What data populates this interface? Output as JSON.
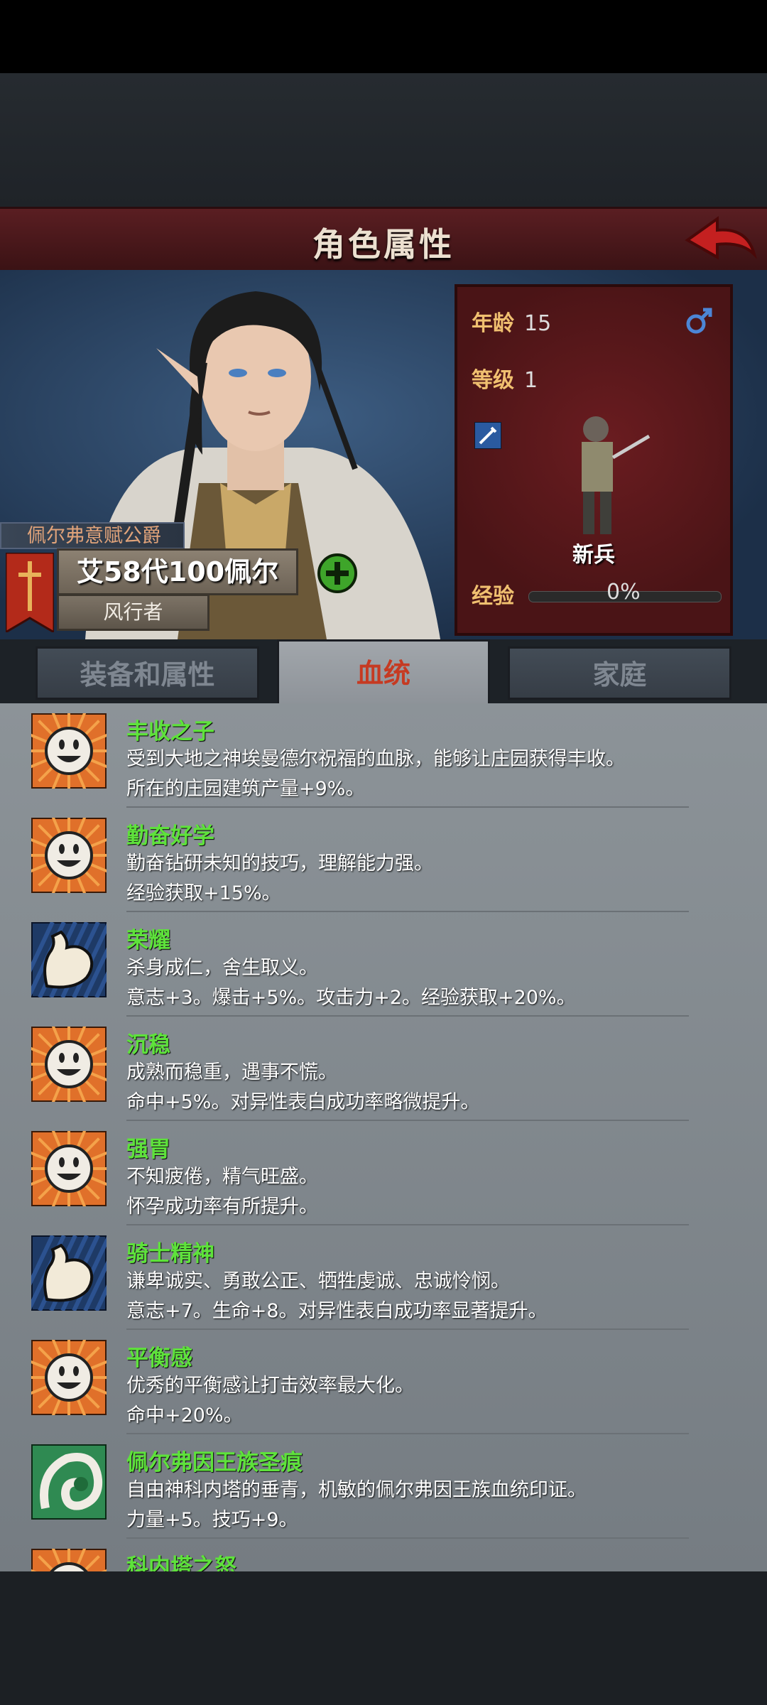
{
  "header": {
    "title": "角色属性"
  },
  "character": {
    "title": "佩尔弗意赋公爵",
    "name": "艾58代100佩尔",
    "class": "风行者",
    "age_label": "年龄",
    "age": "15",
    "level_label": "等级",
    "level": "1",
    "unit_name": "新兵",
    "exp_label": "经验",
    "exp_percent": "0%",
    "exp_fraction": 0
  },
  "tabs": [
    {
      "label": "装备和属性"
    },
    {
      "label": "血统"
    },
    {
      "label": "家庭"
    }
  ],
  "active_tab": 1,
  "traits": [
    {
      "name": "丰收之子",
      "icon": "smiley-icon",
      "desc": "受到大地之神埃曼德尔祝福的血脉，能够让庄园获得丰收。",
      "effect": "所在的庄园建筑产量+9%。"
    },
    {
      "name": "勤奋好学",
      "icon": "smiley-icon",
      "desc": "勤奋钻研未知的技巧，理解能力强。",
      "effect": "经验获取+15%。"
    },
    {
      "name": "荣耀",
      "icon": "muscle-arm-icon",
      "desc": "杀身成仁，舍生取义。",
      "effect": "意志+3。爆击+5%。攻击力+2。经验获取+20%。"
    },
    {
      "name": "沉稳",
      "icon": "smiley-icon",
      "desc": "成熟而稳重，遇事不慌。",
      "effect": "命中+5%。对异性表白成功率略微提升。"
    },
    {
      "name": "强胃",
      "icon": "smiley-icon",
      "desc": "不知疲倦，精气旺盛。",
      "effect": "怀孕成功率有所提升。"
    },
    {
      "name": "骑士精神",
      "icon": "muscle-arm-icon",
      "desc": "谦卑诚实、勇敢公正、牺牲虔诚、忠诚怜悯。",
      "effect": "意志+7。生命+8。对异性表白成功率显著提升。"
    },
    {
      "name": "平衡感",
      "icon": "smiley-icon",
      "desc": "优秀的平衡感让打击效率最大化。",
      "effect": "命中+20%。"
    },
    {
      "name": "佩尔弗因王族圣痕",
      "icon": "swirl-icon",
      "desc": "自由神科内塔的垂青，机敏的佩尔弗因王族血统印证。",
      "effect": "力量+5。技巧+9。"
    },
    {
      "name": "科内塔之怒",
      "icon": "smiley-icon",
      "desc": "",
      "effect": ""
    }
  ]
}
